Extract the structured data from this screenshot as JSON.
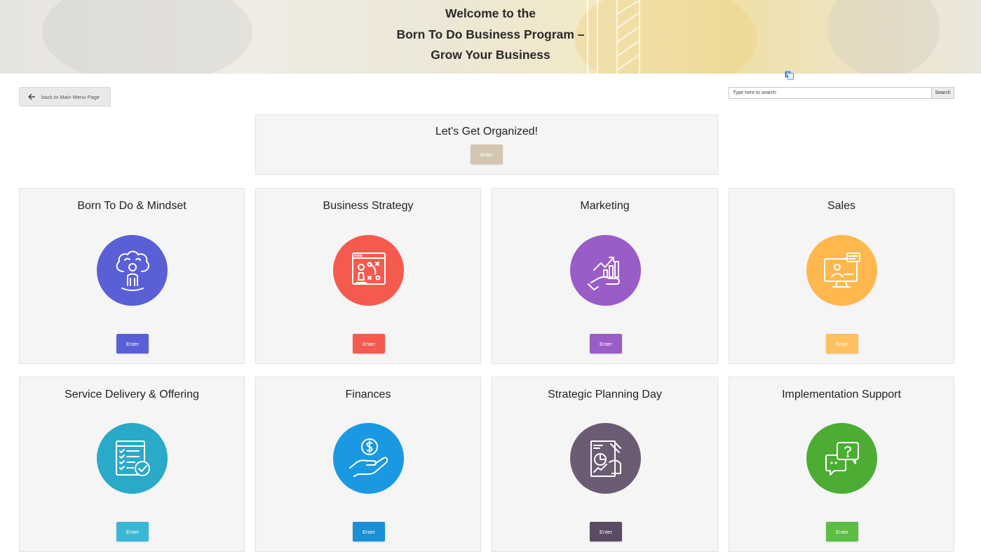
{
  "hero": {
    "line1": "Welcome to the",
    "line2": "Born To Do Business Program –",
    "line3": "Grow Your Business"
  },
  "back_button": {
    "label": "back to Main Menu Page"
  },
  "search": {
    "placeholder": "Type here to search",
    "button_label": "Search"
  },
  "organized": {
    "title": "Let's Get Organized!",
    "button_label": "Enter",
    "button_color": "#d3c7b1"
  },
  "modules": [
    {
      "title": "Born To Do & Mindset",
      "button_label": "Enter",
      "color": "#5b5fd6",
      "icon": "brain-person-icon"
    },
    {
      "title": "Business Strategy",
      "button_label": "Enter",
      "color": "#f55a4e",
      "icon": "strategy-chess-icon"
    },
    {
      "title": "Marketing",
      "button_label": "Enter",
      "color": "#9a5cc6",
      "icon": "growth-chart-hand-icon"
    },
    {
      "title": "Sales",
      "button_label": "Enter",
      "color": "#ffb84d",
      "icon": "monitor-presenter-icon"
    },
    {
      "title": "Service Delivery & Offering",
      "button_label": "Enter",
      "color": "#2aaac9",
      "icon": "checklist-icon"
    },
    {
      "title": "Finances",
      "button_label": "Enter",
      "color": "#1a98e2",
      "icon": "hand-coin-icon"
    },
    {
      "title": "Strategic Planning Day",
      "button_label": "Enter",
      "color": "#6b5b73",
      "icon": "planning-report-icon"
    },
    {
      "title": "Implementation Support",
      "button_label": "Enter",
      "color": "#4cac33",
      "icon": "chat-question-icon"
    }
  ]
}
